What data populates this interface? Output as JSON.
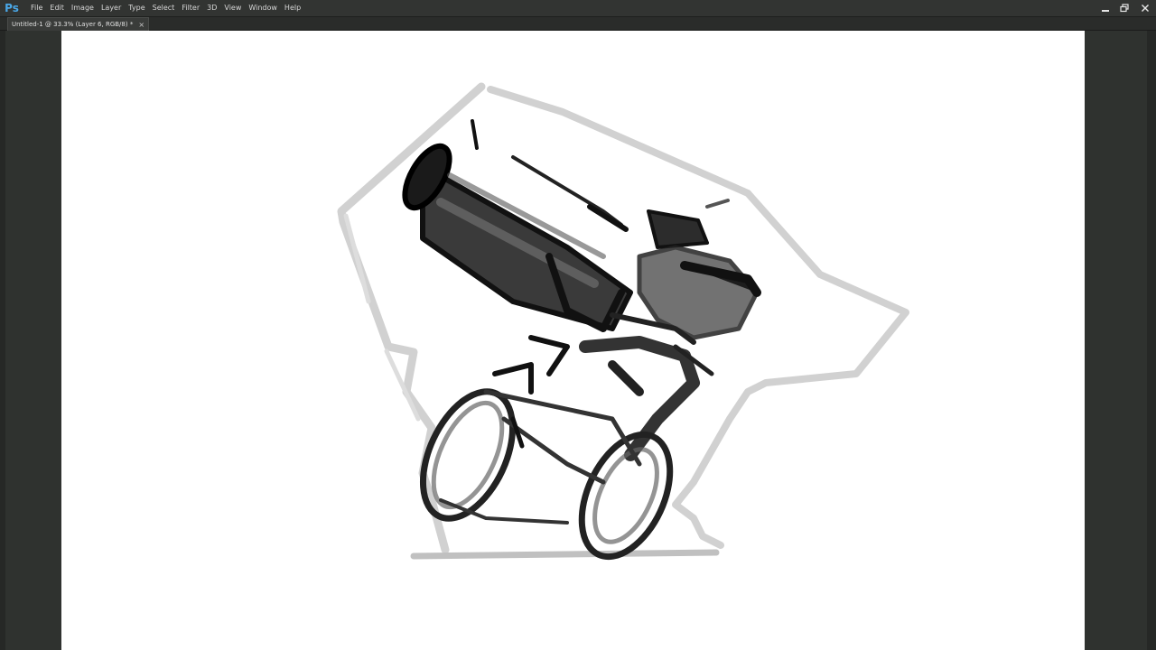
{
  "app": {
    "logo": "Ps",
    "menu": [
      "File",
      "Edit",
      "Image",
      "Layer",
      "Type",
      "Select",
      "Filter",
      "3D",
      "View",
      "Window",
      "Help"
    ],
    "window_controls": {
      "minimize_icon": "minimize-icon",
      "restore_icon": "restore-icon",
      "close_icon": "close-icon"
    }
  },
  "document": {
    "tab_title": "Untitled-1 @ 33.3% (Layer 6, RGB/8) *",
    "tab_close": "×"
  },
  "canvas": {
    "background": "#ffffff",
    "sketch_subject": "sketch-artwork"
  },
  "colors": {
    "menubar": "#323432",
    "workspace": "#2f322f",
    "accent_logo": "#4aa8e8"
  }
}
